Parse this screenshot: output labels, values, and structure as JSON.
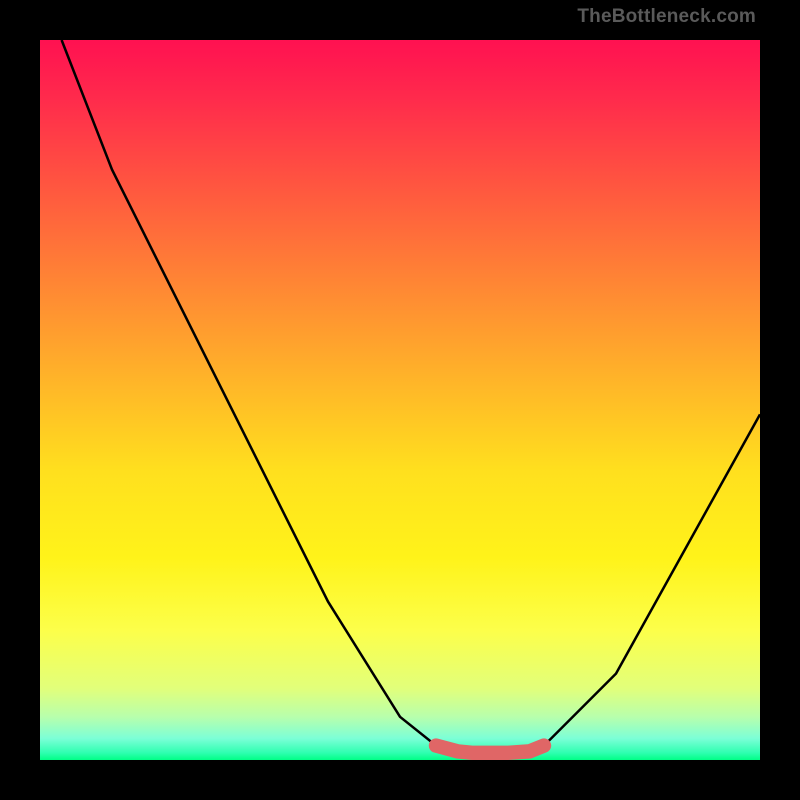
{
  "watermark": {
    "text": "TheBottleneck.com"
  },
  "colors": {
    "background": "#000000",
    "curve": "#000000",
    "highlight": "#e06666",
    "gradient_top": "#ff1151",
    "gradient_bottom": "#00ff86"
  },
  "chart_data": {
    "type": "line",
    "title": "",
    "xlabel": "",
    "ylabel": "",
    "xlim": [
      0,
      100
    ],
    "ylim": [
      0,
      100
    ],
    "grid": false,
    "legend": false,
    "series": [
      {
        "name": "curve",
        "x": [
          3,
          10,
          20,
          30,
          40,
          50,
          55,
          60,
          65,
          70,
          80,
          90,
          100
        ],
        "y": [
          100,
          82,
          62,
          42,
          22,
          6,
          2,
          1,
          1,
          2,
          12,
          30,
          48
        ]
      },
      {
        "name": "bottom-highlight",
        "x": [
          55,
          58,
          60,
          62,
          65,
          68,
          70
        ],
        "y": [
          2.0,
          1.2,
          1.0,
          1.0,
          1.0,
          1.2,
          2.0
        ]
      }
    ]
  }
}
